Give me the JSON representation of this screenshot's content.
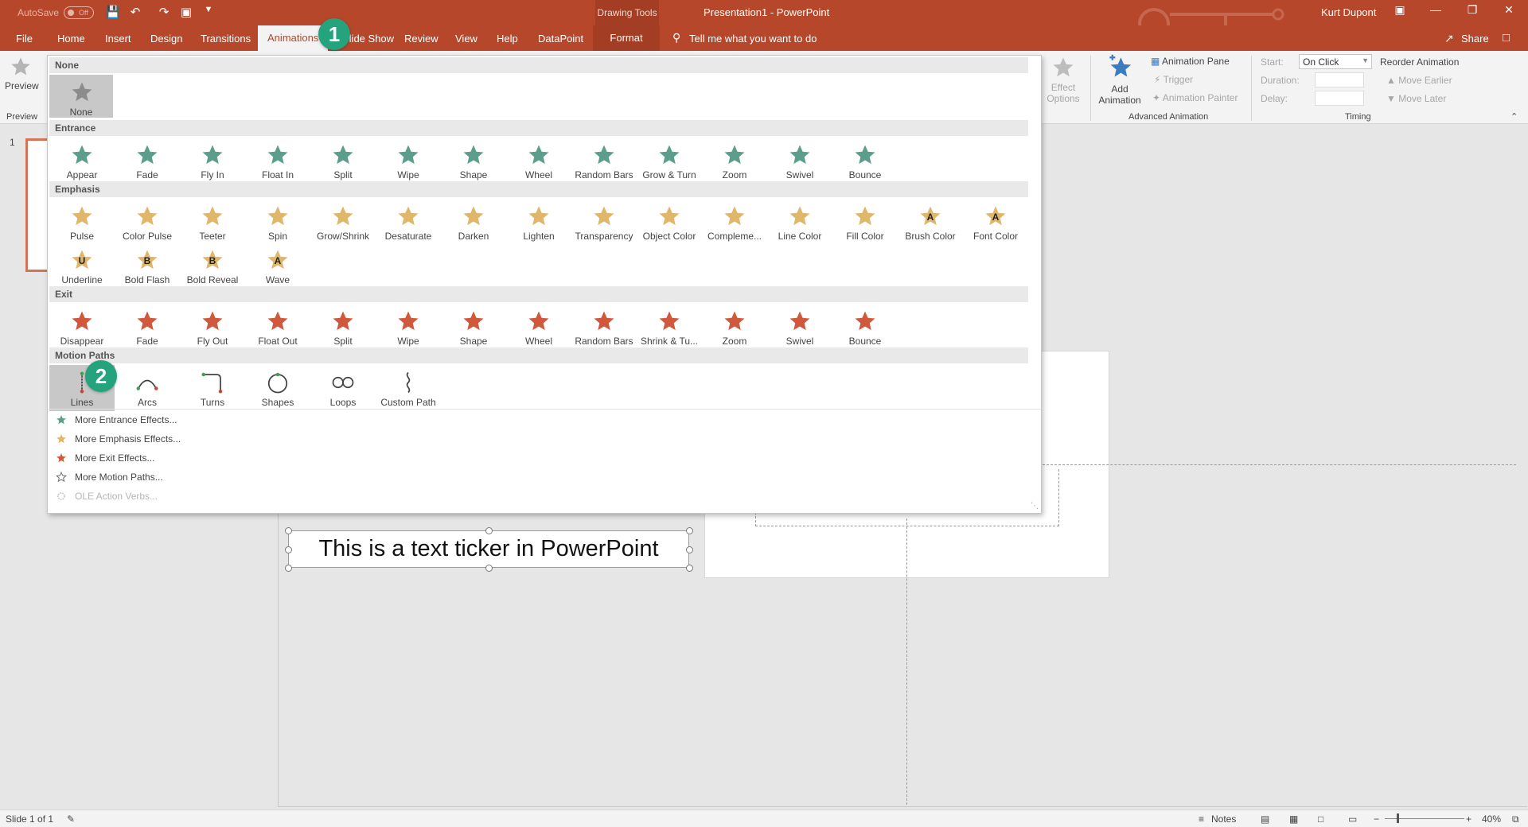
{
  "titlebar": {
    "autosave_label": "AutoSave",
    "autosave_state": "Off",
    "context_tools": "Drawing Tools",
    "doc_title": "Presentation1  -  PowerPoint",
    "user": "Kurt Dupont"
  },
  "tabs": {
    "file": "File",
    "home": "Home",
    "insert": "Insert",
    "design": "Design",
    "transitions": "Transitions",
    "animations": "Animations",
    "slideshow": "Slide Show",
    "review": "Review",
    "view": "View",
    "help": "Help",
    "datapoint": "DataPoint",
    "format": "Format",
    "tellme": "Tell me what you want to do",
    "share": "Share"
  },
  "ribbon": {
    "preview_btn": "Preview",
    "preview_group": "Preview",
    "effect_options_line1": "Effect",
    "effect_options_line2": "Options",
    "add_animation_line1": "Add",
    "add_animation_line2": "Animation",
    "animation_pane": "Animation Pane",
    "trigger": "Trigger",
    "animation_painter": "Animation Painter",
    "advanced_group": "Advanced Animation",
    "start_label": "Start:",
    "start_value": "On Click",
    "duration_label": "Duration:",
    "delay_label": "Delay:",
    "timing_group": "Timing",
    "reorder": "Reorder Animation",
    "move_earlier": "Move Earlier",
    "move_later": "Move Later"
  },
  "gallery": {
    "none_header": "None",
    "none_item": "None",
    "entrance_header": "Entrance",
    "entrance": [
      "Appear",
      "Fade",
      "Fly In",
      "Float In",
      "Split",
      "Wipe",
      "Shape",
      "Wheel",
      "Random Bars",
      "Grow & Turn",
      "Zoom",
      "Swivel",
      "Bounce"
    ],
    "emphasis_header": "Emphasis",
    "emphasis": [
      "Pulse",
      "Color Pulse",
      "Teeter",
      "Spin",
      "Grow/Shrink",
      "Desaturate",
      "Darken",
      "Lighten",
      "Transparency",
      "Object Color",
      "Compleme...",
      "Line Color",
      "Fill Color",
      "Brush Color",
      "Font Color"
    ],
    "emphasis2": [
      "Underline",
      "Bold Flash",
      "Bold Reveal",
      "Wave"
    ],
    "exit_header": "Exit",
    "exit": [
      "Disappear",
      "Fade",
      "Fly Out",
      "Float Out",
      "Split",
      "Wipe",
      "Shape",
      "Wheel",
      "Random Bars",
      "Shrink & Tu...",
      "Zoom",
      "Swivel",
      "Bounce"
    ],
    "motion_header": "Motion Paths",
    "motion": [
      "Lines",
      "Arcs",
      "Turns",
      "Shapes",
      "Loops",
      "Custom Path"
    ],
    "more_entrance": "More Entrance Effects...",
    "more_emphasis": "More Emphasis Effects...",
    "more_exit": "More Exit Effects...",
    "more_motion": "More Motion Paths...",
    "ole_verbs": "OLE Action Verbs..."
  },
  "letters": {
    "brush": "A",
    "font": "A",
    "underline": "U",
    "bold_flash": "B",
    "bold_reveal": "B",
    "wave": "A"
  },
  "slide": {
    "thumb_number": "1",
    "ticker_text": "This is a text ticker in PowerPoint"
  },
  "badges": {
    "one": "1",
    "two": "2"
  },
  "status": {
    "slide_count": "Slide 1 of 1",
    "notes": "Notes",
    "zoom": "40%"
  },
  "colors": {
    "brand": "#b7472a",
    "entrance_star": "#5a9e8b",
    "emphasis_star": "#e0b66a",
    "exit_star": "#d0583d",
    "badge": "#25a37d"
  }
}
